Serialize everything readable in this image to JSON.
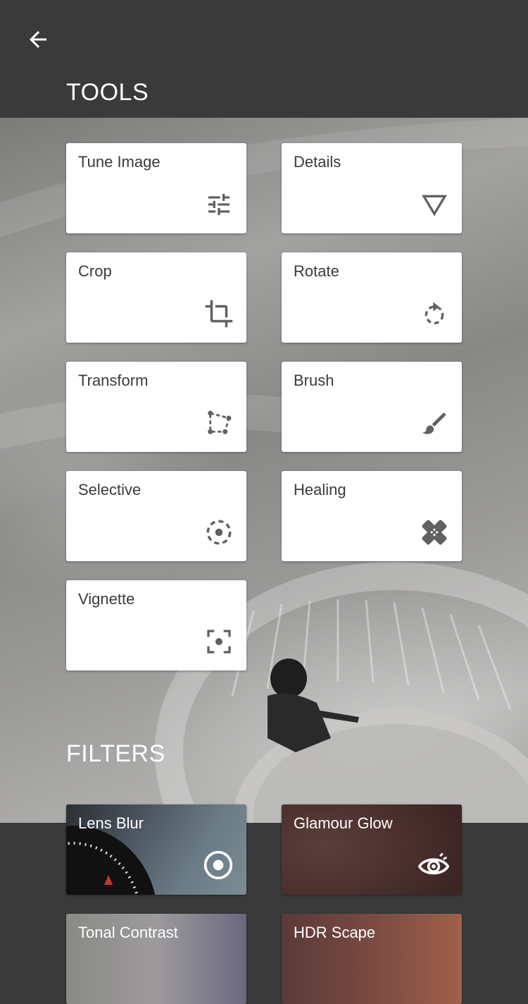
{
  "header": {
    "back_icon": "arrow-left-icon"
  },
  "tools": {
    "title": "TOOLS",
    "items": [
      {
        "label": "Tune Image",
        "icon": "sliders-icon"
      },
      {
        "label": "Details",
        "icon": "triangle-down-icon"
      },
      {
        "label": "Crop",
        "icon": "crop-icon"
      },
      {
        "label": "Rotate",
        "icon": "rotate-icon"
      },
      {
        "label": "Transform",
        "icon": "transform-icon"
      },
      {
        "label": "Brush",
        "icon": "brush-icon"
      },
      {
        "label": "Selective",
        "icon": "selective-icon"
      },
      {
        "label": "Healing",
        "icon": "bandage-icon"
      },
      {
        "label": "Vignette",
        "icon": "vignette-icon"
      }
    ]
  },
  "filters": {
    "title": "FILTERS",
    "items": [
      {
        "label": "Lens Blur",
        "icon": "target-icon"
      },
      {
        "label": "Glamour Glow",
        "icon": "eye-icon"
      },
      {
        "label": "Tonal Contrast",
        "icon": ""
      },
      {
        "label": "HDR Scape",
        "icon": ""
      }
    ]
  },
  "colors": {
    "bar": "#3a3a3a",
    "card": "#ffffff",
    "card_text": "#3a3a3a",
    "icon": "#616161"
  }
}
